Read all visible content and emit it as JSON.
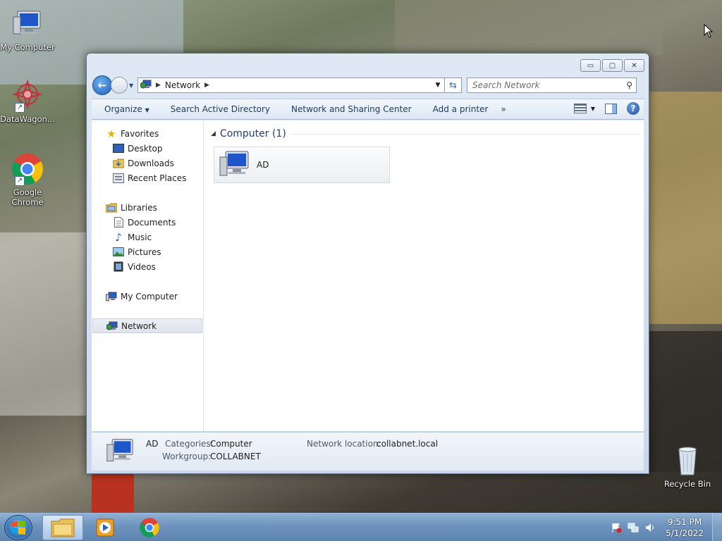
{
  "desktop": {
    "icons": [
      {
        "label": "My Computer",
        "icon": "computer-icon"
      },
      {
        "label": "DataWagon...",
        "icon": "datawagon-icon"
      },
      {
        "label": "Google Chrome",
        "icon": "chrome-icon"
      },
      {
        "label": "Recycle Bin",
        "icon": "recycle-bin-icon"
      }
    ]
  },
  "window": {
    "controls": {
      "minimize": "▭",
      "maximize": "▢",
      "close": "✕"
    },
    "address": {
      "crumb": "Network"
    },
    "search": {
      "placeholder": "Search Network"
    },
    "toolbar": {
      "organize": "Organize",
      "search_ad": "Search Active Directory",
      "sharing_center": "Network and Sharing Center",
      "add_printer": "Add a printer",
      "more": "»"
    },
    "navpane": {
      "favorites": "Favorites",
      "desktop": "Desktop",
      "downloads": "Downloads",
      "recent": "Recent Places",
      "libraries": "Libraries",
      "documents": "Documents",
      "music": "Music",
      "pictures": "Pictures",
      "videos": "Videos",
      "my_computer": "My Computer",
      "network": "Network"
    },
    "group": {
      "title": "Computer (1)"
    },
    "items": [
      {
        "name": "AD"
      }
    ],
    "details": {
      "name": "AD",
      "categories_label": "Categories:",
      "categories_value": "Computer",
      "workgroup_label": "Workgroup:",
      "workgroup_value": "COLLABNET",
      "location_label": "Network location:",
      "location_value": "collabnet.local"
    }
  },
  "taskbar": {
    "clock_time": "9:51 PM",
    "clock_date": "5/1/2022"
  },
  "colors": {
    "accent": "#1e3e76",
    "taskbar": "#6f93bd"
  }
}
